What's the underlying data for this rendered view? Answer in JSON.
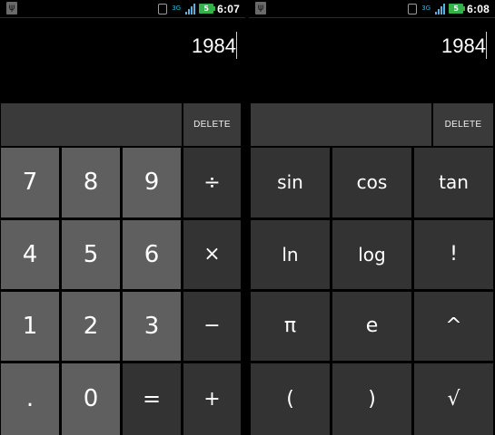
{
  "screens": [
    {
      "status": {
        "network": "3G",
        "battery": "5",
        "time": "6:07"
      },
      "display": {
        "expression": "1984"
      },
      "delete_label": "DELETE",
      "keys": [
        [
          "7",
          "8",
          "9",
          "÷"
        ],
        [
          "4",
          "5",
          "6",
          "×"
        ],
        [
          "1",
          "2",
          "3",
          "−"
        ],
        [
          ".",
          "0",
          "=",
          "+"
        ]
      ]
    },
    {
      "status": {
        "network": "3G",
        "battery": "5",
        "time": "6:08"
      },
      "display": {
        "expression": "1984"
      },
      "delete_label": "DELETE",
      "keys": [
        [
          "sin",
          "cos",
          "tan"
        ],
        [
          "ln",
          "log",
          "!"
        ],
        [
          "π",
          "e",
          "^"
        ],
        [
          "(",
          ")",
          "√"
        ]
      ]
    }
  ],
  "colors": {
    "background": "#000000",
    "digit_key": "#5f5f5f",
    "operator_key": "#333333",
    "text": "#ffffff",
    "network_3g": "#33b5e5",
    "battery": "#34b24a"
  }
}
